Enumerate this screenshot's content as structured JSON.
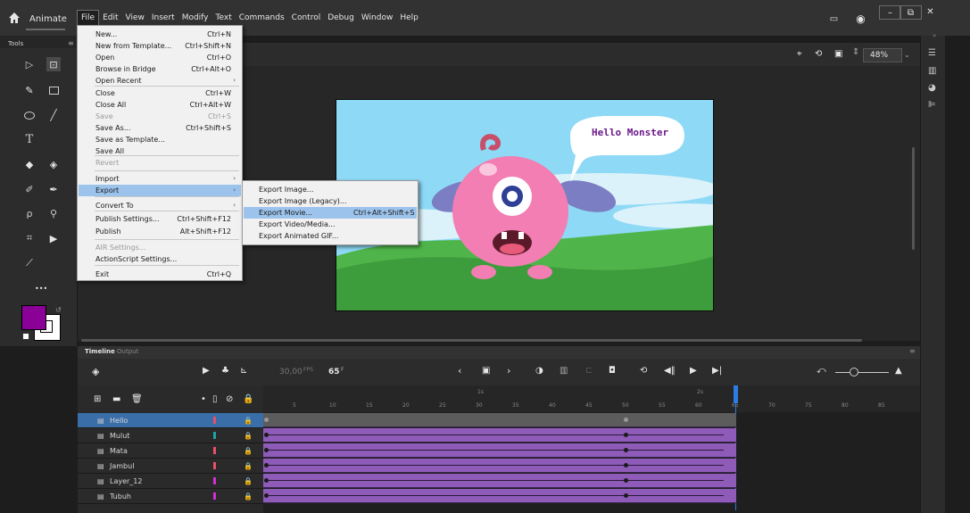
{
  "app": {
    "name": "Animate"
  },
  "menubar": [
    "File",
    "Edit",
    "View",
    "Insert",
    "Modify",
    "Text",
    "Commands",
    "Control",
    "Debug",
    "Window",
    "Help"
  ],
  "tools": {
    "panel_title": "Tools",
    "more_label": "•••"
  },
  "stage": {
    "zoom": "48%",
    "speech_text": "Hello Monster"
  },
  "file_menu": [
    {
      "label": "New...",
      "shortcut": "Ctrl+N"
    },
    {
      "label": "New from Template...",
      "shortcut": "Ctrl+Shift+N"
    },
    {
      "label": "Open",
      "shortcut": "Ctrl+O"
    },
    {
      "label": "Browse in Bridge",
      "shortcut": "Ctrl+Alt+O"
    },
    {
      "label": "Open Recent",
      "shortcut": ""
    },
    {
      "label": "Close",
      "shortcut": "Ctrl+W"
    },
    {
      "label": "Close All",
      "shortcut": "Ctrl+Alt+W"
    },
    {
      "label": "Save",
      "shortcut": "Ctrl+S"
    },
    {
      "label": "Save As...",
      "shortcut": "Ctrl+Shift+S"
    },
    {
      "label": "Save as Template...",
      "shortcut": ""
    },
    {
      "label": "Save All",
      "shortcut": ""
    },
    {
      "label": "Revert",
      "shortcut": ""
    },
    {
      "label": "Import",
      "shortcut": ""
    },
    {
      "label": "Export",
      "shortcut": ""
    },
    {
      "label": "Convert To",
      "shortcut": ""
    },
    {
      "label": "Publish Settings...",
      "shortcut": "Ctrl+Shift+F12"
    },
    {
      "label": "Publish",
      "shortcut": "Alt+Shift+F12"
    },
    {
      "label": "AIR Settings...",
      "shortcut": ""
    },
    {
      "label": "ActionScript Settings...",
      "shortcut": ""
    },
    {
      "label": "Exit",
      "shortcut": "Ctrl+Q"
    }
  ],
  "export_submenu": [
    {
      "label": "Export Image...",
      "shortcut": ""
    },
    {
      "label": "Export Image (Legacy)...",
      "shortcut": ""
    },
    {
      "label": "Export Movie...",
      "shortcut": "Ctrl+Alt+Shift+S"
    },
    {
      "label": "Export Video/Media...",
      "shortcut": ""
    },
    {
      "label": "Export Animated GIF...",
      "shortcut": ""
    }
  ],
  "timeline": {
    "tabs": [
      "Timeline",
      "Output"
    ],
    "fps": "30,00",
    "fps_unit": "FPS",
    "frame": "65",
    "frame_unit": "F",
    "ruler": [
      "5",
      "10",
      "15",
      "20",
      "25",
      "30",
      "35",
      "40",
      "45",
      "50",
      "55",
      "60",
      "65",
      "70",
      "75",
      "80",
      "85"
    ],
    "seconds": [
      "1s",
      "2s"
    ],
    "layers": [
      {
        "name": "Hello",
        "color": "#e8506a"
      },
      {
        "name": "Mulut",
        "color": "#1fa3a3"
      },
      {
        "name": "Mata",
        "color": "#e8506a"
      },
      {
        "name": "Jambul",
        "color": "#e8506a"
      },
      {
        "name": "Layer_12",
        "color": "#d42fd4"
      },
      {
        "name": "Tubuh",
        "color": "#d42fd4"
      }
    ]
  },
  "colors": {
    "stroke": "#8b0096",
    "fill": "#ffffff",
    "highlight": "#9cc3ec",
    "sky": "#8ed9f5",
    "grass": "#4fb54a",
    "monster": "#f27eb3"
  }
}
